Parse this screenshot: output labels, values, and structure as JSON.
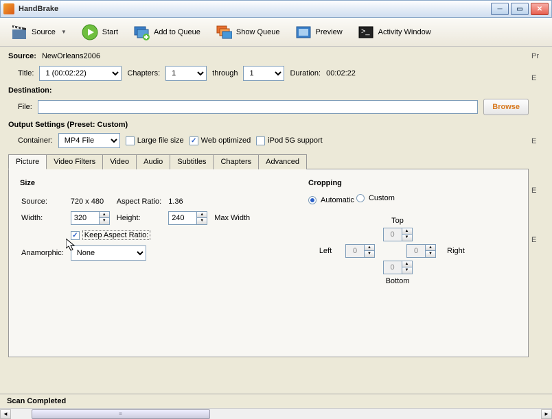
{
  "app": {
    "title": "HandBrake"
  },
  "toolbar": {
    "source": "Source",
    "start": "Start",
    "add_queue": "Add to Queue",
    "show_queue": "Show Queue",
    "preview": "Preview",
    "activity": "Activity Window"
  },
  "source": {
    "label": "Source:",
    "value": "NewOrleans2006",
    "title_label": "Title:",
    "title_value": "1 (00:02:22)",
    "chapters_label": "Chapters:",
    "chapter_from": "1",
    "through_label": "through",
    "chapter_to": "1",
    "duration_label": "Duration:",
    "duration_value": "00:02:22"
  },
  "destination": {
    "heading": "Destination:",
    "file_label": "File:",
    "file_value": "",
    "browse": "Browse"
  },
  "output": {
    "heading": "Output Settings (Preset: Custom)",
    "container_label": "Container:",
    "container_value": "MP4 File",
    "large_file": "Large file size",
    "web_opt": "Web optimized",
    "ipod": "iPod 5G support"
  },
  "tabs": {
    "picture": "Picture",
    "video_filters": "Video Filters",
    "video": "Video",
    "audio": "Audio",
    "subtitles": "Subtitles",
    "chapters": "Chapters",
    "advanced": "Advanced"
  },
  "picture": {
    "size_head": "Size",
    "source_label": "Source:",
    "source_value": "720 x 480",
    "aspect_label": "Aspect Ratio:",
    "aspect_value": "1.36",
    "width_label": "Width:",
    "width_value": "320",
    "height_label": "Height:",
    "height_value": "240",
    "max_width": "Max Width",
    "keep_ar": "Keep Aspect Ratio:",
    "anamorphic_label": "Anamorphic:",
    "anamorphic_value": "None",
    "crop_head": "Cropping",
    "crop_auto": "Automatic",
    "crop_custom": "Custom",
    "top": "Top",
    "bottom": "Bottom",
    "left": "Left",
    "right": "Right",
    "crop_val": "0"
  },
  "right": {
    "p1": "Pr",
    "p2": "E",
    "p3": "E",
    "p4": "E",
    "p5": "E"
  },
  "status": {
    "text": "Scan Completed"
  }
}
